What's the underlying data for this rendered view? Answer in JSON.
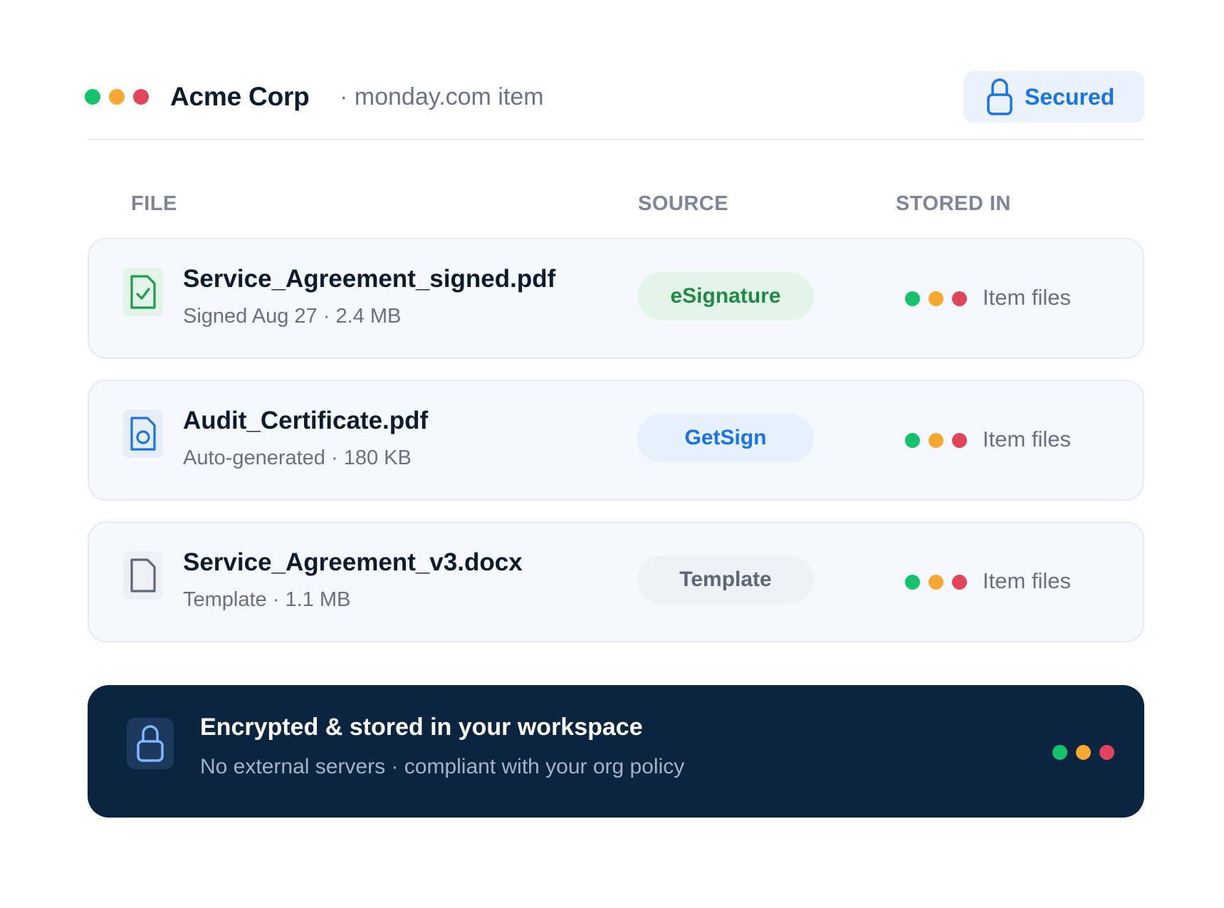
{
  "window": {
    "dots": [
      {
        "color": "#13c26b"
      },
      {
        "color": "#f7a833"
      },
      {
        "color": "#e2445c"
      }
    ]
  },
  "header": {
    "title": "Acme Corp",
    "subtitle": "· monday.com item",
    "badge": {
      "icon": "lock-icon",
      "label": "Secured",
      "color": "#1a73e8",
      "background": "#eaf2fe"
    }
  },
  "table": {
    "columns": {
      "file": "FILE",
      "source": "SOURCE",
      "stored_in": "STORED IN"
    },
    "rows": [
      {
        "icon": "signed-document-icon",
        "icon_color": "#1e9c4b",
        "icon_background": "#e3f4e8",
        "name": "Service_Agreement_signed.pdf",
        "meta": "Signed Aug 27 · 2.4 MB",
        "source": {
          "label": "eSignature",
          "color": "#1e8a45",
          "background": "#e3f5e8"
        },
        "stored_in": "Item files"
      },
      {
        "icon": "certificate-document-icon",
        "icon_color": "#1a73e8",
        "icon_background": "#e6eefb",
        "name": "Audit_Certificate.pdf",
        "meta": "Auto-generated · 180 KB",
        "source": {
          "label": "GetSign",
          "color": "#1a73e8",
          "background": "#e7f0fd"
        },
        "stored_in": "Item files"
      },
      {
        "icon": "blank-document-icon",
        "icon_color": "#5f6777",
        "icon_background": "#edf0f4",
        "name": "Service_Agreement_v3.docx",
        "meta": "Template · 1.1 MB",
        "source": {
          "label": "Template",
          "color": "#5f6777",
          "background": "#eef1f5"
        },
        "stored_in": "Item files"
      }
    ]
  },
  "banner": {
    "icon": "lock-icon",
    "title": "Encrypted & stored in your workspace",
    "subtitle": "No external servers · compliant with your org policy",
    "background": "#0b2541"
  }
}
